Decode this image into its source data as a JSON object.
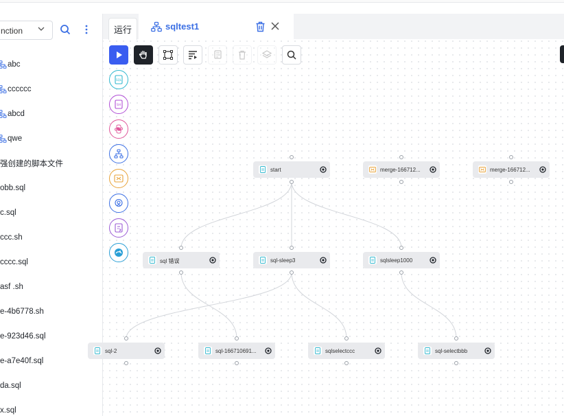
{
  "sidebar": {
    "select_value": "nction",
    "files": [
      {
        "label": "abc",
        "icon": "flow-icon"
      },
      {
        "label": "cccccc",
        "icon": "flow-icon"
      },
      {
        "label": "abcd",
        "icon": "flow-icon"
      },
      {
        "label": "qwe",
        "icon": "flow-icon"
      },
      {
        "label": "强创建的脚本文件",
        "icon": ""
      },
      {
        "label": "obb.sql",
        "icon": ""
      },
      {
        "label": "c.sql",
        "icon": ""
      },
      {
        "label": "ccc.sh",
        "icon": ""
      },
      {
        "label": "cccc.sql",
        "icon": ""
      },
      {
        "label": "asf .sh",
        "icon": ""
      },
      {
        "label": "e-4b6778.sh",
        "icon": ""
      },
      {
        "label": "e-923d46.sql",
        "icon": ""
      },
      {
        "label": "e-a7e40f.sql",
        "icon": ""
      },
      {
        "label": "da.sql",
        "icon": ""
      },
      {
        "label": "x.sql",
        "icon": ""
      }
    ]
  },
  "tabs": {
    "run_label": "运行",
    "active_label": "sqltest1"
  },
  "colors": {
    "accent": "#3b6fe4",
    "primary_button": "#3a5df0",
    "dark_button": "#1f2329",
    "node_bg": "#e9eaed"
  },
  "toolbar": [
    {
      "name": "run-button",
      "icon": "play-icon"
    },
    {
      "name": "pan-button",
      "icon": "hand-icon"
    },
    {
      "name": "select-button",
      "icon": "box-select-icon"
    },
    {
      "name": "format-button",
      "icon": "format-icon"
    },
    {
      "name": "copy-button",
      "icon": "copy-icon"
    },
    {
      "name": "delete-button",
      "icon": "trash-icon"
    },
    {
      "name": "layers-button",
      "icon": "layers-icon"
    },
    {
      "name": "search-button",
      "icon": "search-icon"
    }
  ],
  "palette": [
    "sql-node-icon",
    "shell-node-icon",
    "python-node-icon",
    "subflow-node-icon",
    "merge-node-icon",
    "http-node-icon",
    "dependent-node-icon",
    "ai-node-icon"
  ],
  "nodes": [
    {
      "id": "start",
      "label": "start",
      "type": "sql"
    },
    {
      "id": "merge1",
      "label": "merge-166712...",
      "type": "merge"
    },
    {
      "id": "merge2",
      "label": "merge-166712...",
      "type": "merge"
    },
    {
      "id": "sqlerr",
      "label": "sql 错误",
      "type": "sql"
    },
    {
      "id": "sleep3",
      "label": "sql-sleep3",
      "type": "sql"
    },
    {
      "id": "sleep1000",
      "label": "sqlsleep1000",
      "type": "sql"
    },
    {
      "id": "sql2",
      "label": "sql-2",
      "type": "sql"
    },
    {
      "id": "sql1667",
      "label": "sql-166710691...",
      "type": "sql"
    },
    {
      "id": "selectccc",
      "label": "sqlselectccc",
      "type": "sql"
    },
    {
      "id": "selectbbb",
      "label": "sql-selectbbb",
      "type": "sql"
    }
  ],
  "edges": [
    [
      "start",
      "sqlerr"
    ],
    [
      "start",
      "sleep3"
    ],
    [
      "start",
      "sleep1000"
    ],
    [
      "sqlerr",
      "sql1667"
    ],
    [
      "sleep3",
      "sql2"
    ],
    [
      "sleep3",
      "selectccc"
    ],
    [
      "sleep1000",
      "selectbbb"
    ]
  ]
}
